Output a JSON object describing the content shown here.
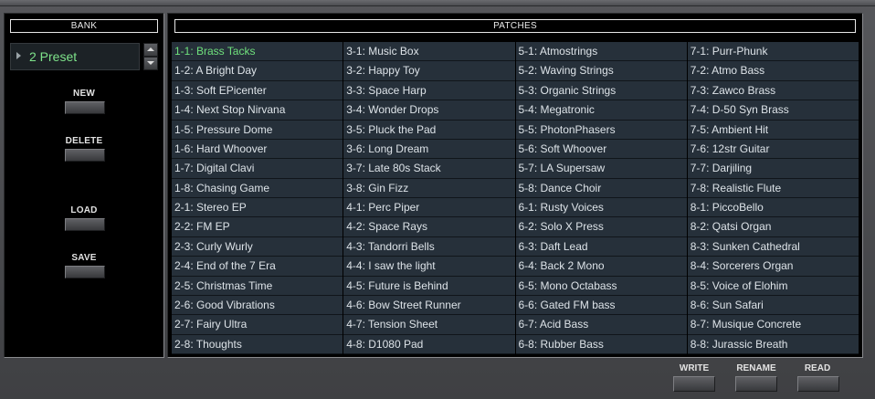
{
  "bank": {
    "header": "BANK",
    "preset_label": "2 Preset",
    "buttons": {
      "new": "NEW",
      "delete": "DELETE",
      "load": "LOAD",
      "save": "SAVE"
    }
  },
  "patches": {
    "header": "PATCHES",
    "selected": "1-1: Brass Tacks",
    "selected_color": "#6fe07c",
    "columns": [
      [
        "1-1: Brass Tacks",
        "1-2: A Bright Day",
        "1-3: Soft EPicenter",
        "1-4: Next Stop Nirvana",
        "1-5: Pressure Dome",
        "1-6: Hard Whoover",
        "1-7: Digital Clavi",
        "1-8: Chasing Game",
        "2-1: Stereo EP",
        "2-2: FM EP",
        "2-3: Curly Wurly",
        "2-4: End of the 7 Era",
        "2-5: Christmas Time",
        "2-6: Good Vibrations",
        "2-7: Fairy Ultra",
        "2-8: Thoughts"
      ],
      [
        "3-1: Music Box",
        "3-2: Happy Toy",
        "3-3: Space Harp",
        "3-4: Wonder Drops",
        "3-5: Pluck the Pad",
        "3-6: Long Dream",
        "3-7: Late 80s Stack",
        "3-8: Gin Fizz",
        "4-1: Perc Piper",
        "4-2: Space Rays",
        "4-3: Tandorri Bells",
        "4-4: I saw the light",
        "4-5: Future is Behind",
        "4-6: Bow Street Runner",
        "4-7: Tension Sheet",
        "4-8: D1080 Pad"
      ],
      [
        "5-1: Atmostrings",
        "5-2: Waving Strings",
        "5-3: Organic Strings",
        "5-4: Megatronic",
        "5-5: PhotonPhasers",
        "5-6: Soft Whoover",
        "5-7: LA Supersaw",
        "5-8: Dance Choir",
        "6-1: Rusty Voices",
        "6-2: Solo X Press",
        "6-3: Daft Lead",
        "6-4: Back 2 Mono",
        "6-5: Mono Octabass",
        "6-6: Gated FM bass",
        "6-7: Acid Bass",
        "6-8: Rubber Bass"
      ],
      [
        "7-1: Purr-Phunk",
        "7-2: Atmo Bass",
        "7-3: Zawco Brass",
        "7-4: D-50 Syn Brass",
        "7-5: Ambient Hit",
        "7-6: 12str Guitar",
        "7-7: Darjiling",
        "7-8: Realistic Flute",
        "8-1: PiccoBello",
        "8-2: Qatsi Organ",
        "8-3: Sunken Cathedral",
        "8-4: Sorcerers Organ",
        "8-5: Voice of Elohim",
        "8-6: Sun Safari",
        "8-7: Musique Concrete",
        "8-8: Jurassic Breath"
      ]
    ]
  },
  "footer": {
    "write": "WRITE",
    "rename": "RENAME",
    "read": "READ"
  }
}
